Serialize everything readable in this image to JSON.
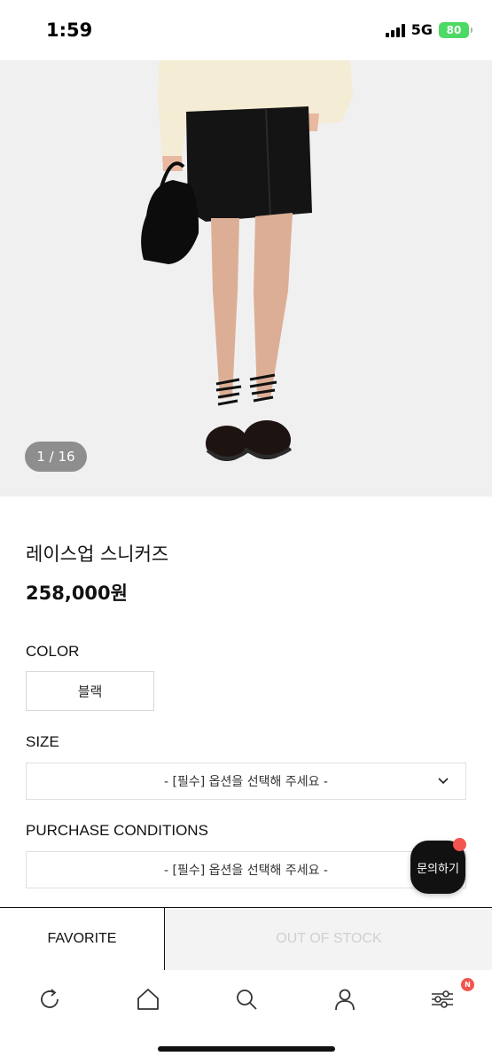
{
  "status_bar": {
    "time": "1:59",
    "network": "5G",
    "battery": "80"
  },
  "gallery": {
    "counter": "1 / 16"
  },
  "product": {
    "name": "레이스업 스니커즈",
    "price": "258,000원"
  },
  "options": {
    "color_label": "COLOR",
    "color_value": "블랙",
    "size_label": "SIZE",
    "size_placeholder": "- [필수] 옵션을 선택해 주세요 -",
    "conditions_label": "PURCHASE CONDITIONS",
    "conditions_placeholder": "- [필수] 옵션을 선택해 주세요 -"
  },
  "inquiry": {
    "label": "문의하기"
  },
  "actions": {
    "favorite": "FAVORITE",
    "out_of_stock": "OUT OF STOCK"
  },
  "bottom_nav": {
    "items": [
      "refresh-icon",
      "home-icon",
      "search-icon",
      "user-icon",
      "settings-sliders-icon"
    ],
    "badge": "N"
  },
  "colors": {
    "badge": "#f2554e",
    "battery": "#4cd964",
    "disabled_text": "#d0d0d0"
  }
}
